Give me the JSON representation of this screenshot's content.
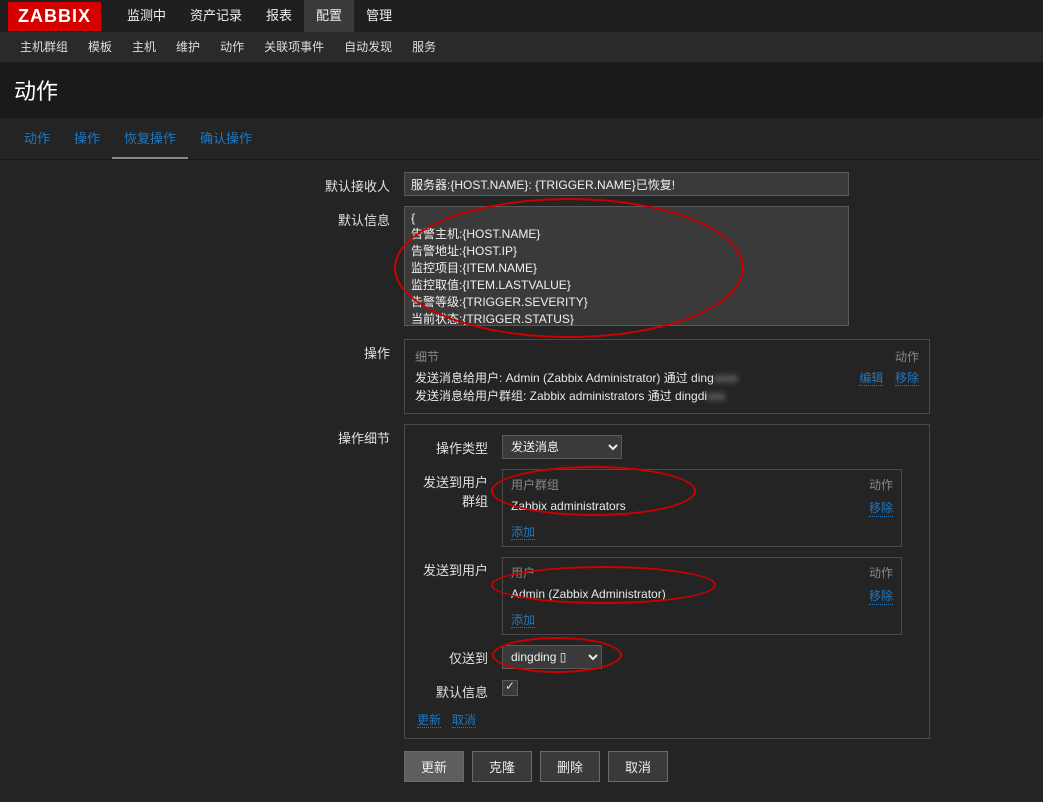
{
  "logo": "ZABBIX",
  "topnav": [
    "监测中",
    "资产记录",
    "报表",
    "配置",
    "管理"
  ],
  "topnav_active": 3,
  "subnav": [
    "主机群组",
    "模板",
    "主机",
    "维护",
    "动作",
    "关联项事件",
    "自动发现",
    "服务"
  ],
  "subnav_active": 4,
  "page_title": "动作",
  "tabs": [
    "动作",
    "操作",
    "恢复操作",
    "确认操作"
  ],
  "tabs_active": 2,
  "form": {
    "recipient_label": "默认接收人",
    "recipient_value": "服务器:{HOST.NAME}: {TRIGGER.NAME}已恢复!",
    "message_label": "默认信息",
    "message_value": "{\n告警主机:{HOST.NAME}\n告警地址:{HOST.IP}\n监控项目:{ITEM.NAME}\n监控取值:{ITEM.LASTVALUE}\n告警等级:{TRIGGER.SEVERITY}\n当前状态:{TRIGGER.STATUS}",
    "ops_label": "操作",
    "ops_detail": "细节",
    "ops_action": "动作",
    "ops_line1": "发送消息给用户: Admin (Zabbix Administrator) 通过 ding",
    "ops_line2": "发送消息给用户群组: Zabbix administrators 通过 dingdi",
    "edit": "编辑",
    "remove": "移除",
    "detail_label": "操作细节",
    "op_type_label": "操作类型",
    "op_type_value": "发送消息",
    "send_usergroup_label": "发送到用户群组",
    "ug_header": "用户群组",
    "ug_value": "Zabbix administrators",
    "add": "添加",
    "send_user_label": "发送到用户",
    "u_header": "用户",
    "u_value": "Admin (Zabbix Administrator)",
    "sendto_label": "仅送到",
    "sendto_value": "dingding",
    "defmsg_label": "默认信息",
    "update2": "更新",
    "cancel2": "取消"
  },
  "buttons": {
    "update": "更新",
    "clone": "克隆",
    "delete": "删除",
    "cancel": "取消"
  }
}
